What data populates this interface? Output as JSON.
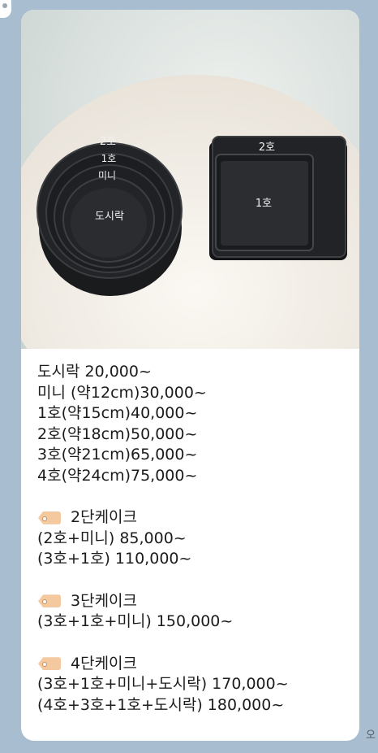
{
  "photo": {
    "round_pan_labels": [
      "2호",
      "1호",
      "미니",
      "도시락"
    ],
    "square_pan_labels": [
      "2호",
      "1호"
    ]
  },
  "message": {
    "prices": [
      "도시락 20,000~",
      "미니 (약12cm)30,000~",
      "1호(약15cm)40,000~",
      "2호(약18cm)50,000~",
      "3호(약21cm)65,000~",
      "4호(약24cm)75,000~"
    ],
    "tier2": {
      "heading": "2단케이크",
      "items": [
        "(2호+미니) 85,000~",
        "(3호+1호) 110,000~"
      ]
    },
    "tier3": {
      "heading": "3단케이크",
      "items": [
        "(3호+1호+미니) 150,000~"
      ]
    },
    "tier4": {
      "heading": "4단케이크",
      "items": [
        "(3호+1호+미니+도시락) 170,000~",
        "(4호+3호+1호+도시락) 180,000~"
      ]
    }
  },
  "side_marker": "오",
  "icons": {
    "tag": "label-tag-icon"
  }
}
